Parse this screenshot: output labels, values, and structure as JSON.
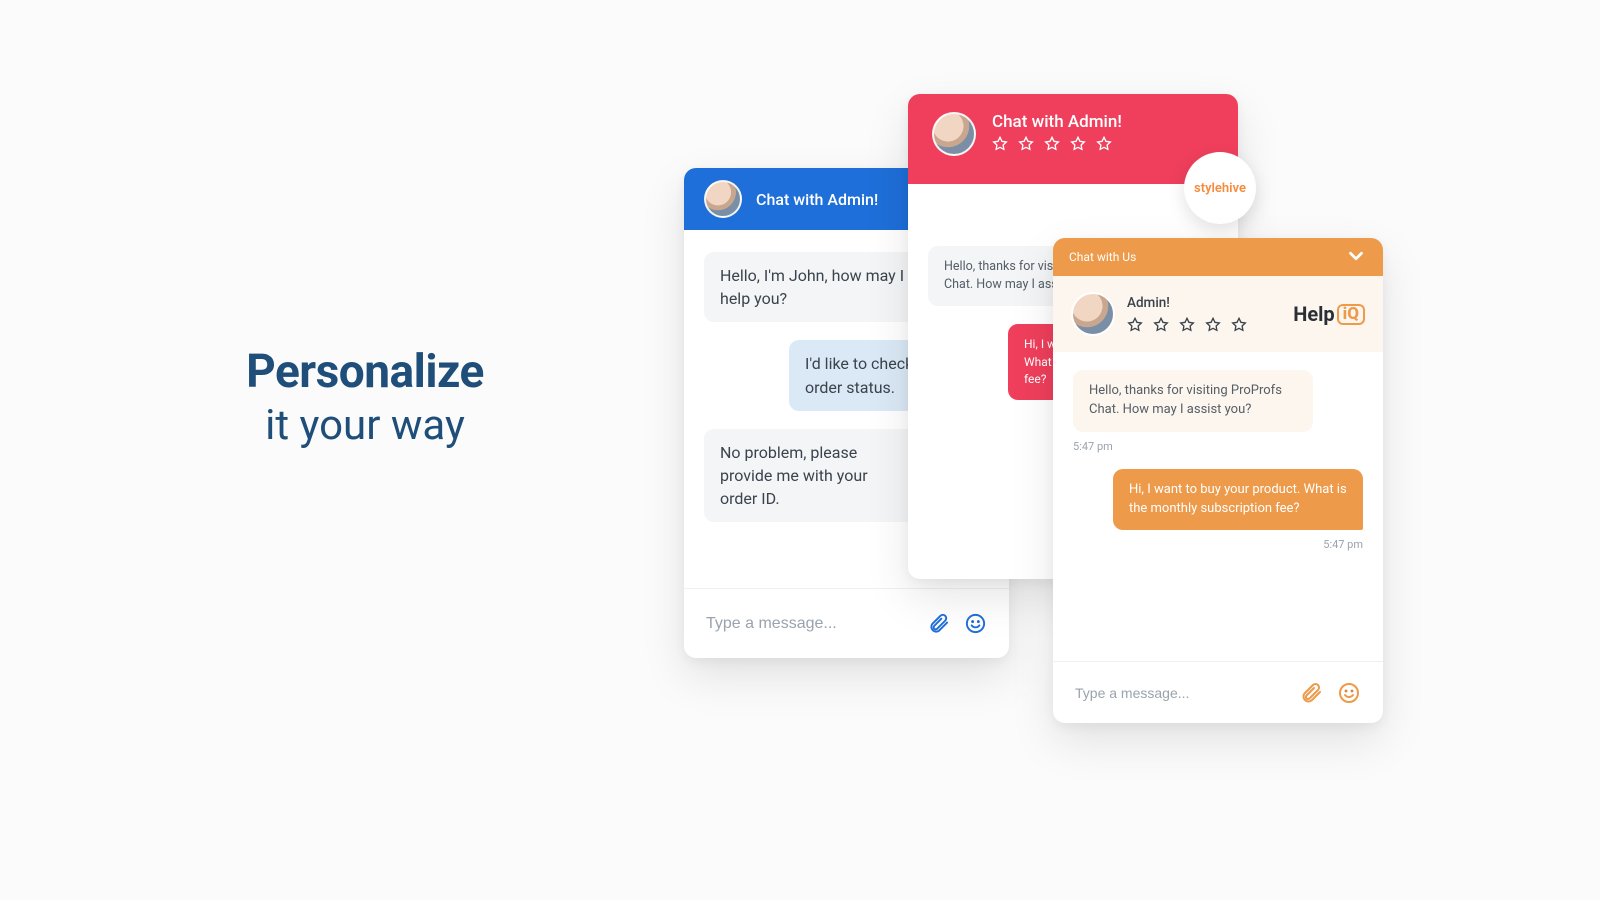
{
  "headline": {
    "line1": "Personalize",
    "line2": "it your way"
  },
  "blue": {
    "title": "Chat with Admin!",
    "messages": {
      "m1": "Hello, I'm John, how may I help you?",
      "m2": "I'd like to check my order status.",
      "m3": "No problem, please provide me with your order ID."
    },
    "input_placeholder": "Type a message..."
  },
  "pink": {
    "title": "Chat with Admin!",
    "brand": "stylehive",
    "messages": {
      "m1": "Hello, thanks for visiting ProProfs Chat. How may I assist you?",
      "m2": "Hi, I want to buy your product. What is the monthly subscription fee?"
    }
  },
  "orange": {
    "header": "Chat with Us",
    "admin_name": "Admin!",
    "brand_a": "Help",
    "brand_b": "iQ",
    "messages": {
      "m1": "Hello, thanks for visiting ProProfs Chat. How may I assist you?",
      "t1": "5:47 pm",
      "m2": "Hi, I want to buy your product. What is the monthly subscription fee?",
      "t2": "5:47 pm"
    },
    "input_placeholder": "Type a message..."
  }
}
